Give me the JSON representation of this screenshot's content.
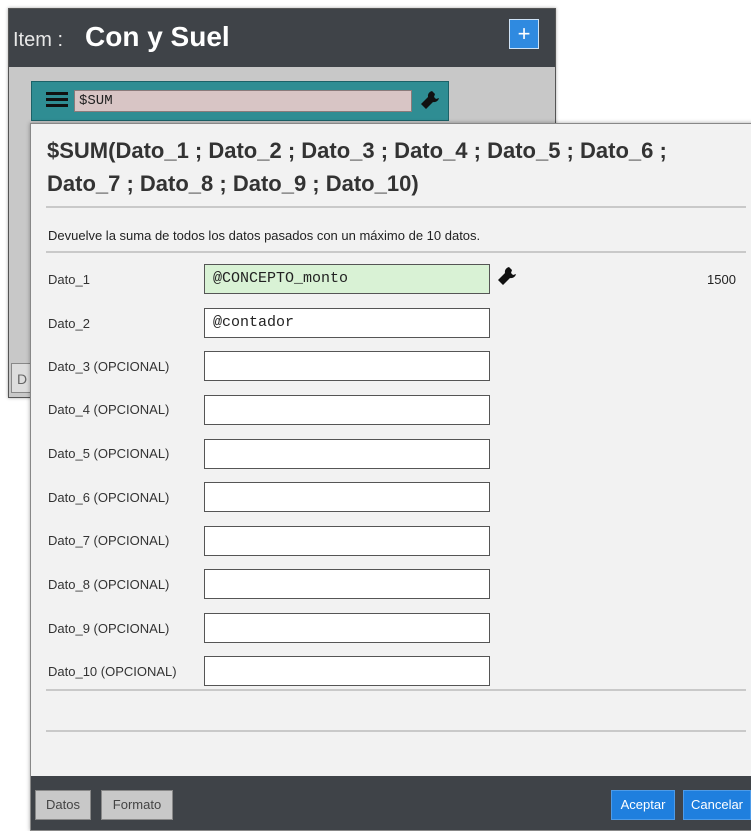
{
  "item_window": {
    "prefix": "Item :",
    "name": "Con y Suel",
    "add_button": "+",
    "formula_value": "$SUM",
    "left_stub_text": "D"
  },
  "dialog": {
    "title": "$SUM(Dato_1 ; Dato_2 ; Dato_3 ; Dato_4 ; Dato_5 ; Dato_6 ; Dato_7 ; Dato_8 ; Dato_9 ; Dato_10)",
    "description": "Devuelve la suma de todos los datos pasados con un máximo de 10 datos.",
    "params": [
      {
        "label": "Dato_1",
        "value": "@CONCEPTO_monto",
        "result": "1500"
      },
      {
        "label": "Dato_2",
        "value": "@contador"
      },
      {
        "label": "Dato_3 (OPCIONAL)",
        "value": ""
      },
      {
        "label": "Dato_4 (OPCIONAL)",
        "value": ""
      },
      {
        "label": "Dato_5 (OPCIONAL)",
        "value": ""
      },
      {
        "label": "Dato_6 (OPCIONAL)",
        "value": ""
      },
      {
        "label": "Dato_7 (OPCIONAL)",
        "value": ""
      },
      {
        "label": "Dato_8 (OPCIONAL)",
        "value": ""
      },
      {
        "label": "Dato_9 (OPCIONAL)",
        "value": ""
      },
      {
        "label": "Dato_10 (OPCIONAL)",
        "value": ""
      }
    ],
    "footer": {
      "tab_datos": "Datos",
      "tab_formato": "Formato",
      "accept": "Aceptar",
      "cancel": "Cancelar"
    }
  },
  "colors": {
    "header_bg": "#3f4348",
    "accent_blue": "#1f7fde",
    "formula_teal": "#2f8d93",
    "active_param_green": "#d9f2d5"
  }
}
